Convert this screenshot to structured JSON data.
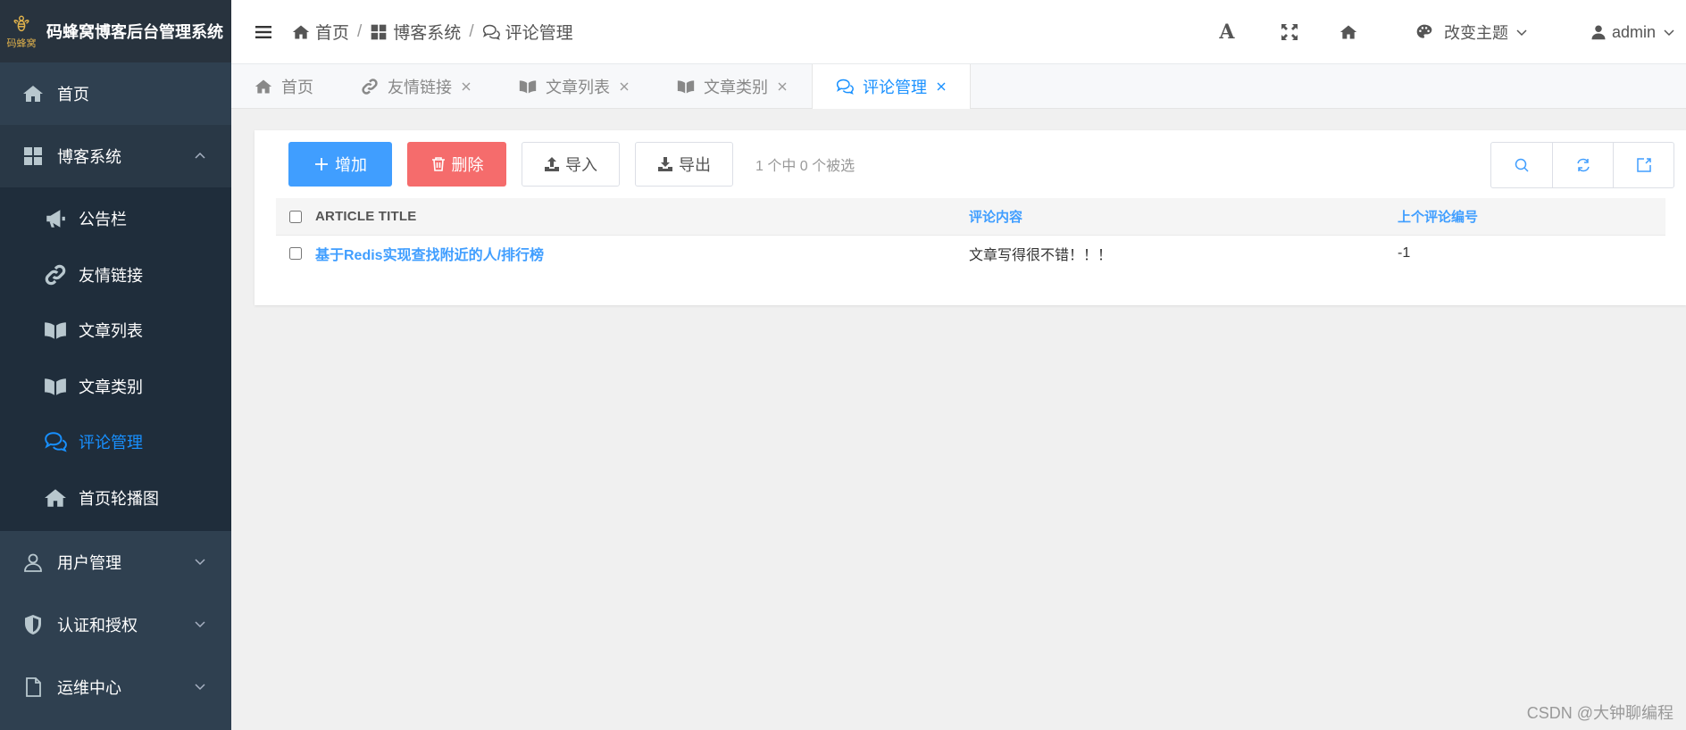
{
  "logo": {
    "title": "码蜂窝博客后台管理系统",
    "small": "码蜂窝"
  },
  "sidebar": {
    "home": "首页",
    "blog": "博客系统",
    "blog_items": [
      {
        "label": "公告栏",
        "icon": "bullhorn-icon"
      },
      {
        "label": "友情链接",
        "icon": "link-icon"
      },
      {
        "label": "文章列表",
        "icon": "book-icon"
      },
      {
        "label": "文章类别",
        "icon": "book-icon"
      },
      {
        "label": "评论管理",
        "icon": "comments-icon",
        "active": true
      },
      {
        "label": "首页轮播图",
        "icon": "home-icon"
      }
    ],
    "user_mgmt": "用户管理",
    "auth": "认证和授权",
    "ops": "运维中心"
  },
  "breadcrumb": {
    "home": "首页",
    "blog": "博客系统",
    "current": "评论管理"
  },
  "topbar": {
    "font_label": "A",
    "theme_label": "改变主题",
    "user": "admin"
  },
  "tabs": [
    {
      "label": "首页",
      "icon": "home-icon",
      "closable": false
    },
    {
      "label": "友情链接",
      "icon": "link-icon",
      "closable": true
    },
    {
      "label": "文章列表",
      "icon": "book-icon",
      "closable": true
    },
    {
      "label": "文章类别",
      "icon": "book-icon",
      "closable": true
    },
    {
      "label": "评论管理",
      "icon": "comments-icon",
      "closable": true,
      "active": true
    }
  ],
  "toolbar": {
    "add": "增加",
    "delete": "删除",
    "import": "导入",
    "export": "导出",
    "selection": "1 个中 0 个被选"
  },
  "table": {
    "headers": {
      "title": "ARTICLE TITLE",
      "content": "评论内容",
      "prev": "上个评论编号"
    },
    "rows": [
      {
        "title": "基于Redis实现查找附近的人/排行榜",
        "content": "文章写得很不错！！！",
        "prev": "-1"
      }
    ]
  },
  "watermark": "CSDN @大钟聊编程",
  "colors": {
    "sidebar": "#2f4050",
    "accent": "#409eff",
    "danger": "#f56c6c"
  }
}
